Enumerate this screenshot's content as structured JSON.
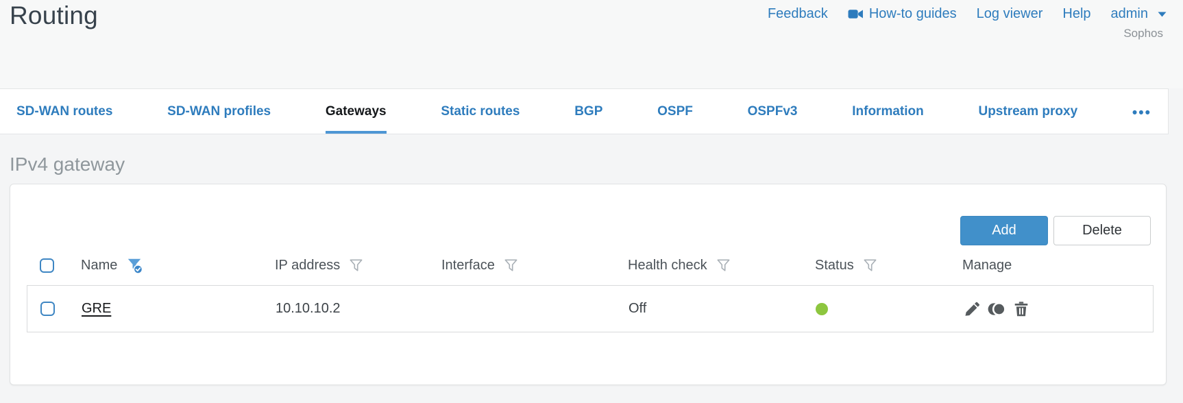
{
  "header": {
    "title": "Routing",
    "nav": {
      "feedback": "Feedback",
      "howto_guides": "How-to guides",
      "log_viewer": "Log viewer",
      "help": "Help",
      "user": "admin",
      "account": "Sophos"
    }
  },
  "tabs": [
    {
      "label": "SD-WAN routes",
      "active": false
    },
    {
      "label": "SD-WAN profiles",
      "active": false
    },
    {
      "label": "Gateways",
      "active": true
    },
    {
      "label": "Static routes",
      "active": false
    },
    {
      "label": "BGP",
      "active": false
    },
    {
      "label": "OSPF",
      "active": false
    },
    {
      "label": "OSPFv3",
      "active": false
    },
    {
      "label": "Information",
      "active": false
    },
    {
      "label": "Upstream proxy",
      "active": false
    }
  ],
  "tabs_overflow": "•••",
  "section": {
    "title": "IPv4 gateway"
  },
  "toolbar": {
    "add_label": "Add",
    "delete_label": "Delete"
  },
  "table": {
    "columns": [
      {
        "label": "Name",
        "filter": "active"
      },
      {
        "label": "IP address",
        "filter": "inactive"
      },
      {
        "label": "Interface",
        "filter": "inactive"
      },
      {
        "label": "Health check",
        "filter": "inactive"
      },
      {
        "label": "Status",
        "filter": "inactive"
      },
      {
        "label": "Manage",
        "filter": "none"
      }
    ],
    "rows": [
      {
        "name": "GRE",
        "ip_address": "10.10.10.2",
        "interface": "",
        "health_check": "Off",
        "status": "up",
        "manage_icons": [
          "edit-icon",
          "clone-icon",
          "delete-icon"
        ]
      }
    ]
  },
  "colors": {
    "link_blue": "#2e7cbd",
    "button_blue": "#4190ca",
    "active_tab_underline": "#4e96d4",
    "filter_active_blue": "#5b9fd8",
    "status_up_green": "#8dc63f"
  }
}
